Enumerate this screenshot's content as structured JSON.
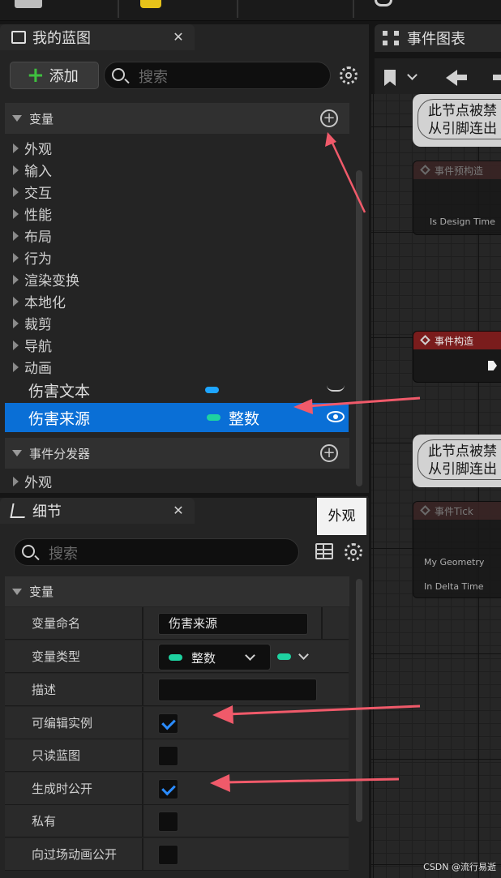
{
  "my_blueprint": {
    "title": "我的蓝图",
    "add_label": "添加",
    "search_placeholder": "搜索",
    "variables_header": "变量",
    "categories": [
      "外观",
      "输入",
      "交互",
      "性能",
      "布局",
      "行为",
      "渲染变换",
      "本地化",
      "裁剪",
      "导航",
      "动画"
    ],
    "variables": [
      {
        "name": "伤害文本",
        "type": "",
        "color": "#1ea5ff",
        "selected": false
      },
      {
        "name": "伤害来源",
        "type": "整数",
        "color": "#1ed2a0",
        "selected": true
      }
    ],
    "dispatchers_header": "事件分发器",
    "dispatcher_categories": [
      "外观"
    ]
  },
  "details": {
    "title": "细节",
    "search_placeholder": "搜索",
    "tooltip": "外观",
    "section": "变量",
    "rows": {
      "var_name_label": "变量命名",
      "var_name_value": "伤害来源",
      "var_type_label": "变量类型",
      "var_type_value": "整数",
      "description_label": "描述",
      "editable_label": "可编辑实例",
      "readonly_label": "只读蓝图",
      "expose_label": "生成时公开",
      "private_label": "私有",
      "expose_cinematic_label": "向过场动画公开"
    },
    "checkbox_states": {
      "editable": true,
      "readonly": false,
      "expose": true,
      "private": false,
      "cinematic": false
    }
  },
  "event_graph": {
    "title": "事件图表",
    "comment_line1": "此节点被禁",
    "comment_line2": "从引脚连出",
    "node_preconstruct": "事件预构造",
    "pin_is_design_time": "Is Design Time",
    "node_construct": "事件构造",
    "node_tick": "事件Tick",
    "pin_my_geometry": "My Geometry",
    "pin_in_delta_time": "In Delta Time"
  },
  "colors": {
    "accent_blue": "#0a6fd6",
    "arrow_red": "#f05a6a",
    "int_green": "#1ed2a0",
    "text_blue": "#1ea5ff"
  },
  "watermark": "CSDN @流行易逝"
}
